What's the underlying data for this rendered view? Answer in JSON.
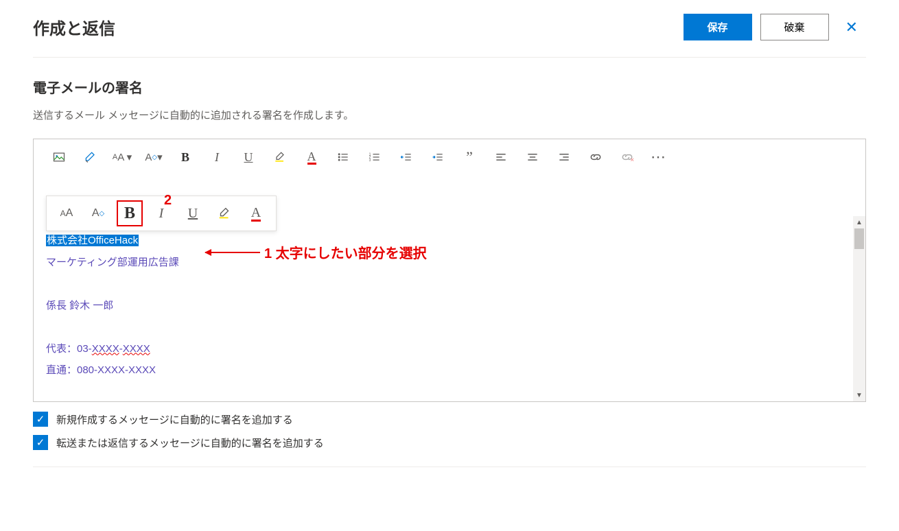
{
  "header": {
    "title": "作成と返信",
    "save": "保存",
    "discard": "破棄"
  },
  "section": {
    "heading": "電子メールの署名",
    "description": "送信するメール メッセージに自動的に追加される署名を作成します。"
  },
  "signature": {
    "line1": "株式会社OfficeHack",
    "line2": "マーケティング部運用広告課",
    "line3": "係長  鈴木 一郎",
    "line4_prefix": "代表：03-",
    "line4_wavy1": "XXXX",
    "line4_sep": "-",
    "line4_wavy2": "XXXX",
    "line5": "直通：080-XXXX-XXXX"
  },
  "annotations": {
    "num2": "2",
    "text1": "1 太字にしたい部分を選択"
  },
  "checkboxes": {
    "c1": "新規作成するメッセージに自動的に署名を追加する",
    "c2": "転送または返信するメッセージに自動的に署名を追加する"
  },
  "icons": {
    "more": "⋯"
  }
}
